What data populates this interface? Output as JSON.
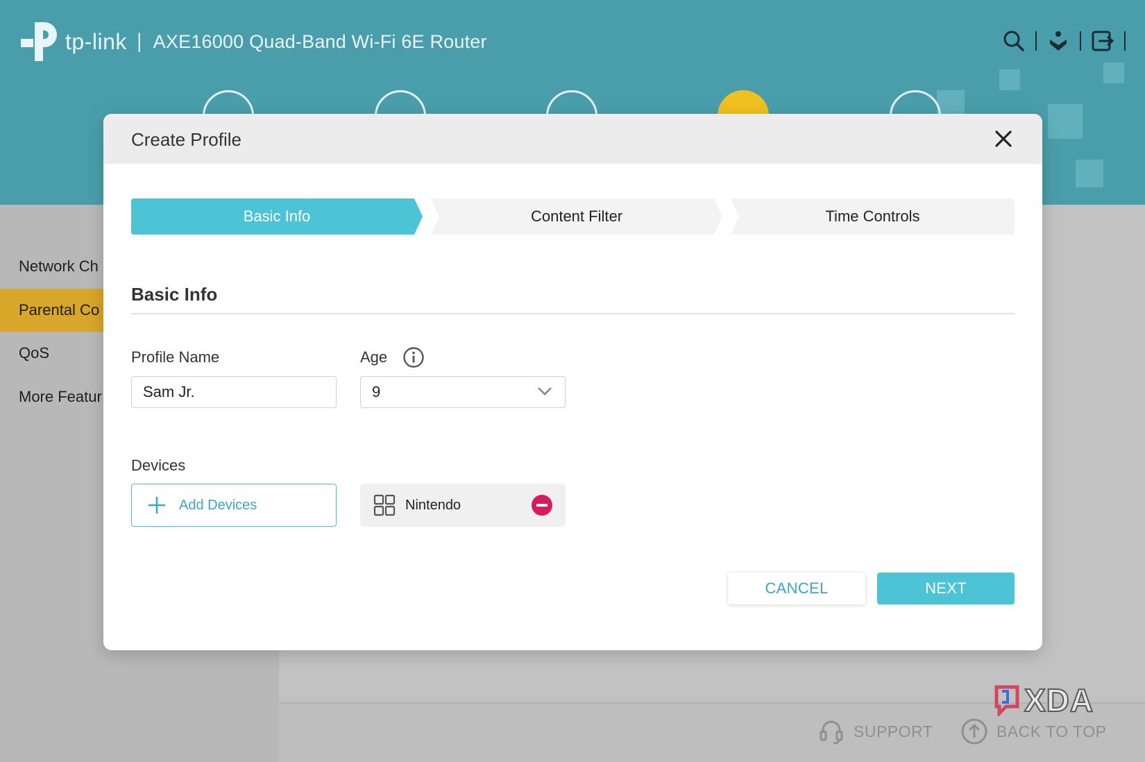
{
  "header": {
    "brand": "tp-link",
    "separator": "|",
    "router_name": "AXE16000 Quad-Band Wi-Fi 6E Router"
  },
  "sidebar": {
    "items": [
      {
        "label": "Network Ch"
      },
      {
        "label": "Parental Co",
        "active": true
      },
      {
        "label": "QoS"
      },
      {
        "label": "More Featur"
      }
    ]
  },
  "footer": {
    "support_label": "SUPPORT",
    "back_to_top_label": "BACK TO TOP"
  },
  "watermark": "XDA",
  "modal": {
    "title": "Create Profile",
    "steps": [
      {
        "label": "Basic Info",
        "active": true
      },
      {
        "label": "Content Filter",
        "active": false
      },
      {
        "label": "Time Controls",
        "active": false
      }
    ],
    "section_title": "Basic Info",
    "profile_name": {
      "label": "Profile Name",
      "value": "Sam Jr."
    },
    "age": {
      "label": "Age",
      "value": "9"
    },
    "devices": {
      "label": "Devices",
      "add_label": "Add Devices",
      "items": [
        {
          "name": "Nintendo"
        }
      ]
    },
    "cancel_label": "CANCEL",
    "next_label": "NEXT"
  },
  "colors": {
    "header_teal": "#4a9eab",
    "accent_teal": "#4cc4d5",
    "active_sidebar": "#d8a628",
    "remove_red": "#d91a5c"
  }
}
